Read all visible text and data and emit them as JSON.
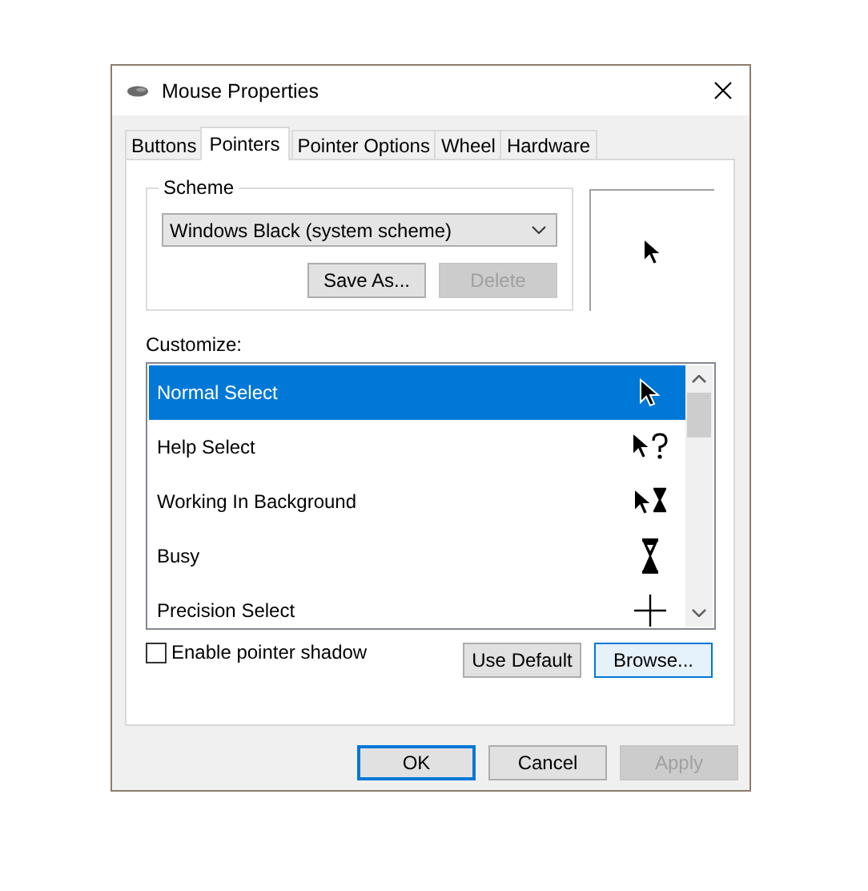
{
  "window": {
    "title": "Mouse Properties"
  },
  "tabs": [
    {
      "label": "Buttons",
      "selected": false
    },
    {
      "label": "Pointers",
      "selected": true
    },
    {
      "label": "Pointer Options",
      "selected": false
    },
    {
      "label": "Wheel",
      "selected": false
    },
    {
      "label": "Hardware",
      "selected": false
    }
  ],
  "scheme": {
    "label": "Scheme",
    "value": "Windows Black (system scheme)",
    "buttons": [
      {
        "label": "Save As...",
        "disabled": false,
        "focused": false
      },
      {
        "label": "Delete",
        "disabled": true,
        "focused": false
      }
    ]
  },
  "preview": {
    "kind": "arrow"
  },
  "customize": {
    "label": "Customize:",
    "items": [
      {
        "name": "Normal Select",
        "kind": "arrow",
        "selected": true
      },
      {
        "name": "Help Select",
        "kind": "help",
        "selected": false
      },
      {
        "name": "Working In Background",
        "kind": "working",
        "selected": false
      },
      {
        "name": "Busy",
        "kind": "busy",
        "selected": false
      },
      {
        "name": "Precision Select",
        "kind": "crosshair",
        "selected": false
      }
    ]
  },
  "shadow": {
    "label": "Enable pointer shadow",
    "checked": false
  },
  "list_buttons": [
    {
      "label": "Use Default",
      "disabled": false,
      "focused": false
    },
    {
      "label": "Browse...",
      "disabled": false,
      "focused": true
    }
  ],
  "dialog_buttons": [
    {
      "label": "OK",
      "disabled": false,
      "focused": true
    },
    {
      "label": "Cancel",
      "disabled": false,
      "focused": false
    },
    {
      "label": "Apply",
      "disabled": true,
      "focused": false
    }
  ]
}
